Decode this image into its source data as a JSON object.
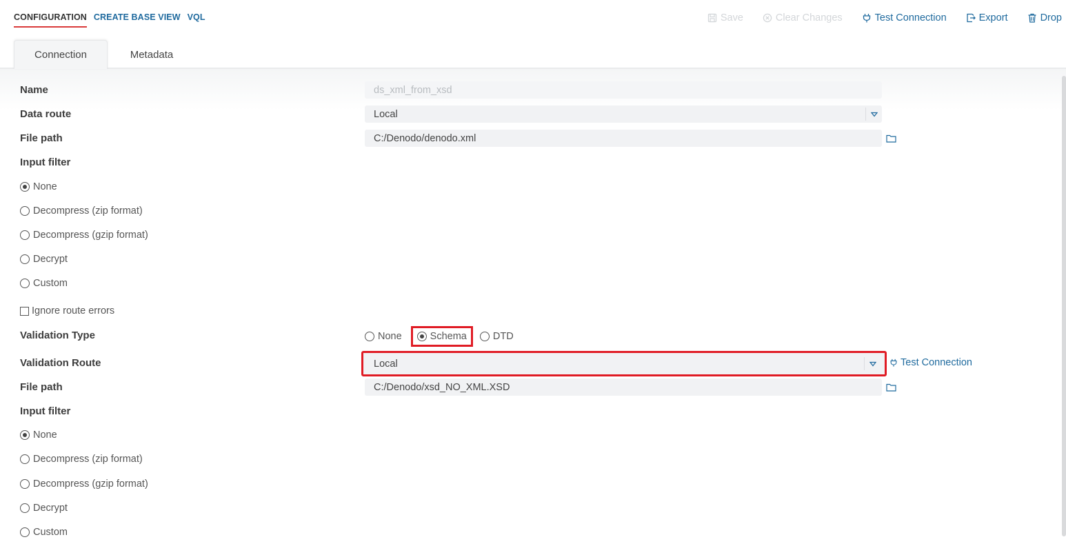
{
  "topnav": {
    "tabs": [
      "CONFIGURATION",
      "CREATE BASE VIEW",
      "VQL"
    ]
  },
  "actions": {
    "save": "Save",
    "clear": "Clear Changes",
    "test": "Test Connection",
    "export": "Export",
    "drop": "Drop"
  },
  "subtabs": {
    "connection": "Connection",
    "metadata": "Metadata"
  },
  "form": {
    "name_label": "Name",
    "name_value": "ds_xml_from_xsd",
    "data_route_label": "Data route",
    "data_route_value": "Local",
    "file_path_label": "File path",
    "file_path_value": "C:/Denodo/denodo.xml",
    "input_filter_label": "Input filter",
    "filter_options": [
      "None",
      "Decompress (zip format)",
      "Decompress (gzip format)",
      "Decrypt",
      "Custom"
    ],
    "ignore_errors_label": "Ignore route errors",
    "validation_type_label": "Validation Type",
    "validation_types": [
      "None",
      "Schema",
      "DTD"
    ],
    "validation_route_label": "Validation Route",
    "validation_route_value": "Local",
    "validation_test": "Test Connection",
    "file_path2_label": "File path",
    "file_path2_value": "C:/Denodo/xsd_NO_XML.XSD",
    "input_filter2_label": "Input filter"
  },
  "colors": {
    "accent": "#1f6a9e",
    "highlight": "#e01b24",
    "active_underline": "#d93a3a"
  }
}
